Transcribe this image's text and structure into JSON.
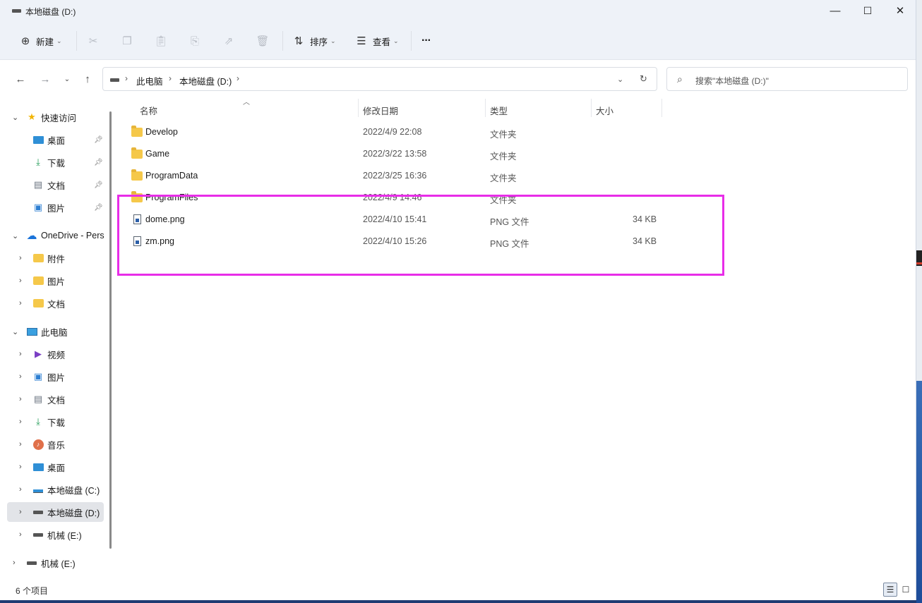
{
  "window": {
    "title": "本地磁盘 (D:)",
    "minimize_icon": "—",
    "maximize_icon": "☐",
    "close_icon": "✕"
  },
  "toolbar": {
    "new_label": "新建",
    "sort_label": "排序",
    "view_label": "查看",
    "more_label": "···"
  },
  "address": {
    "crumbs": [
      "此电脑",
      "本地磁盘 (D:)"
    ],
    "search_placeholder": "搜索\"本地磁盘 (D:)\""
  },
  "sidebar": {
    "items": [
      {
        "label": "快速访问",
        "icon": "star-icon"
      },
      {
        "label": "桌面",
        "icon": "desktop-icon",
        "pinned": true
      },
      {
        "label": "下载",
        "icon": "download-icon",
        "pinned": true
      },
      {
        "label": "文档",
        "icon": "document-icon",
        "pinned": true
      },
      {
        "label": "图片",
        "icon": "picture-icon",
        "pinned": true
      },
      {
        "label": "OneDrive - Pers",
        "icon": "cloud-icon"
      },
      {
        "label": "附件",
        "icon": "folder-icon"
      },
      {
        "label": "图片",
        "icon": "folder-icon"
      },
      {
        "label": "文档",
        "icon": "folder-icon"
      },
      {
        "label": "此电脑",
        "icon": "computer-icon"
      },
      {
        "label": "视频",
        "icon": "video-icon"
      },
      {
        "label": "图片",
        "icon": "picture-icon"
      },
      {
        "label": "文档",
        "icon": "document-icon"
      },
      {
        "label": "下载",
        "icon": "download-icon"
      },
      {
        "label": "音乐",
        "icon": "music-icon"
      },
      {
        "label": "桌面",
        "icon": "desktop-icon"
      },
      {
        "label": "本地磁盘 (C:)",
        "icon": "drive-c-icon"
      },
      {
        "label": "本地磁盘 (D:)",
        "icon": "drive-icon",
        "selected": true
      },
      {
        "label": "机械 (E:)",
        "icon": "drive-icon"
      },
      {
        "label": "机械 (E:)",
        "icon": "drive-icon"
      }
    ]
  },
  "columns": {
    "name": "名称",
    "date": "修改日期",
    "type": "类型",
    "size": "大小"
  },
  "files": [
    {
      "name": "Develop",
      "date": "2022/4/9 22:08",
      "type": "文件夹",
      "size": "",
      "kind": "folder"
    },
    {
      "name": "Game",
      "date": "2022/3/22 13:58",
      "type": "文件夹",
      "size": "",
      "kind": "folder"
    },
    {
      "name": "ProgramData",
      "date": "2022/3/25 16:36",
      "type": "文件夹",
      "size": "",
      "kind": "folder"
    },
    {
      "name": "ProgramFiles",
      "date": "2022/4/9 14:46",
      "type": "文件夹",
      "size": "",
      "kind": "folder"
    },
    {
      "name": "dome.png",
      "date": "2022/4/10 15:41",
      "type": "PNG 文件",
      "size": "34 KB",
      "kind": "png"
    },
    {
      "name": "zm.png",
      "date": "2022/4/10 15:26",
      "type": "PNG 文件",
      "size": "34 KB",
      "kind": "png"
    }
  ],
  "status": {
    "count_text": "6 个项目"
  },
  "colors": {
    "highlight_border": "#e82de8",
    "folder": "#f5c84a",
    "selected_bg": "#e2e4e8"
  }
}
